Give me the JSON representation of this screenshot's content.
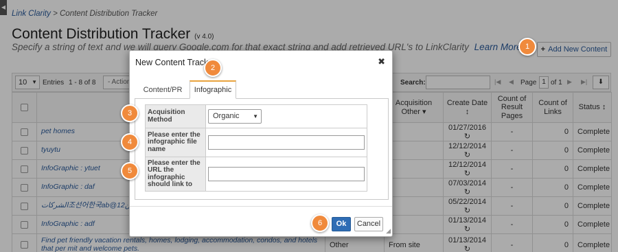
{
  "breadcrumb": {
    "root": "Link Clarity",
    "sep": " > ",
    "current": "Content Distribution Tracker"
  },
  "page": {
    "title": "Content Distribution Tracker",
    "version": "(v 4.0)",
    "subtitle": "Specify a string of text and we will query Google.com for that exact string and add retrieved URL's to LinkClarity",
    "learn_more": "Learn More",
    "add_button": "Add New Content"
  },
  "toolbar": {
    "entries_value": "10",
    "entries_label": "Entries",
    "range": "1 - 8 of 8",
    "action": "- Action",
    "search_label": "Search:",
    "page_label": "Page",
    "page_value": "1",
    "of_label": "of 1"
  },
  "table": {
    "headers": {
      "acq_other": "Acquisition Other ▾",
      "create_date": "Create Date ↕",
      "result_pages": "Count of Result Pages",
      "links": "Count of Links",
      "status": "Status ↕"
    },
    "rows": [
      {
        "title": "pet homes",
        "acq": "",
        "acq_other": "",
        "date": "01/27/2016",
        "pages": "-",
        "links": "0",
        "status": "Complete"
      },
      {
        "title": "tyuytu",
        "acq": "",
        "acq_other": "",
        "date": "12/12/2014",
        "pages": "-",
        "links": "0",
        "status": "Complete"
      },
      {
        "title": "InfoGraphic : ytuet",
        "acq": "",
        "acq_other": "",
        "date": "12/12/2014",
        "pages": "-",
        "links": "0",
        "status": "Complete"
      },
      {
        "title": "InfoGraphic : daf",
        "acq": "",
        "acq_other": "",
        "date": "07/03/2014",
        "pages": "-",
        "links": "0",
        "status": "Complete"
      },
      {
        "title": "الشركات조선어한국ab@12نن",
        "acq": "",
        "acq_other": "",
        "date": "05/22/2014",
        "pages": "-",
        "links": "0",
        "status": "Complete"
      },
      {
        "title": "InfoGraphic : adf",
        "acq": "",
        "acq_other": "",
        "date": "01/13/2014",
        "pages": "-",
        "links": "0",
        "status": "Complete"
      },
      {
        "title": "Find pet friendly vacation rentals, homes, lodging, accommodation, condos, and hotels that per mit and welcome pets.",
        "acq": "Other",
        "acq_other": "From site",
        "date": "01/13/2014",
        "pages": "-",
        "links": "0",
        "status": "Complete"
      }
    ]
  },
  "modal": {
    "title": "New Content Track",
    "tabs": [
      "Content/PR",
      "Infographic"
    ],
    "fields": {
      "method_label": "Acquisition Method",
      "method_value": "Organic",
      "filename_label": "Please enter the infographic file name",
      "url_label": "Please enter the URL the infographic should link to"
    },
    "ok": "Ok",
    "cancel": "Cancel"
  },
  "badges": [
    "1",
    "2",
    "3",
    "4",
    "5",
    "6"
  ],
  "colors": {
    "badge": "#f08a3c",
    "primary": "#2f6db5",
    "link": "#2a5a9a",
    "tab_accent": "#e8a33d"
  }
}
